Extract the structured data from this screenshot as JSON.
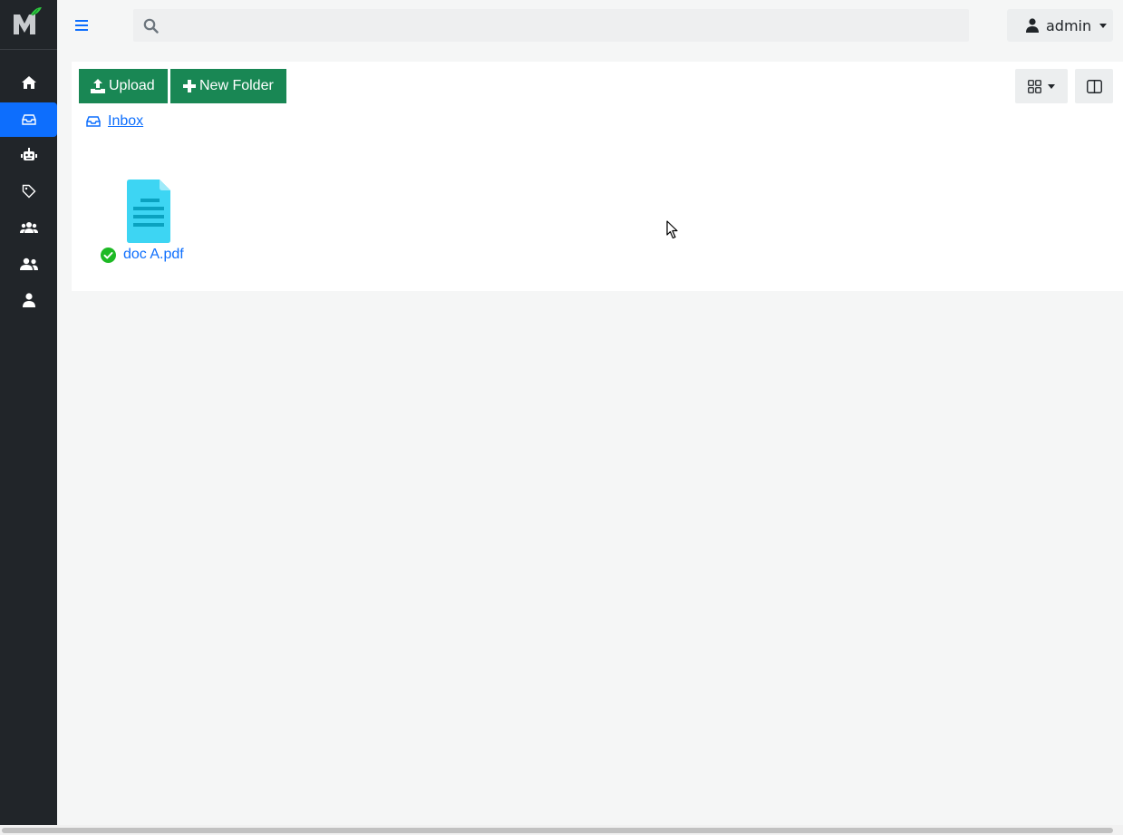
{
  "app": {
    "logo": "mayan-edms-logo",
    "accent_color": "#0d6efd",
    "sidebar_bg": "#212529"
  },
  "sidebar": {
    "items": [
      {
        "icon": "home-icon",
        "active": false
      },
      {
        "icon": "inbox-icon",
        "active": true
      },
      {
        "icon": "robot-icon",
        "active": false
      },
      {
        "icon": "tag-icon",
        "active": false
      },
      {
        "icon": "users-group-icon",
        "active": false
      },
      {
        "icon": "user-friends-icon",
        "active": false
      },
      {
        "icon": "user-icon",
        "active": false
      }
    ]
  },
  "header": {
    "menu_icon": "hamburger-icon",
    "search": {
      "placeholder": "",
      "value": "",
      "icon": "search-icon"
    },
    "user": {
      "label": "admin",
      "icon": "user-icon"
    }
  },
  "toolbar": {
    "upload_label": "Upload",
    "new_folder_label": "New Folder",
    "button_color": "#198754",
    "view_icon": "grid-icon",
    "split_icon": "split-panel-icon"
  },
  "breadcrumb": {
    "icon": "inbox-icon",
    "label": "Inbox"
  },
  "files": [
    {
      "name": "doc A.pdf",
      "icon": "file-lines-icon",
      "status": "ok",
      "status_icon": "check-circle-icon"
    }
  ]
}
